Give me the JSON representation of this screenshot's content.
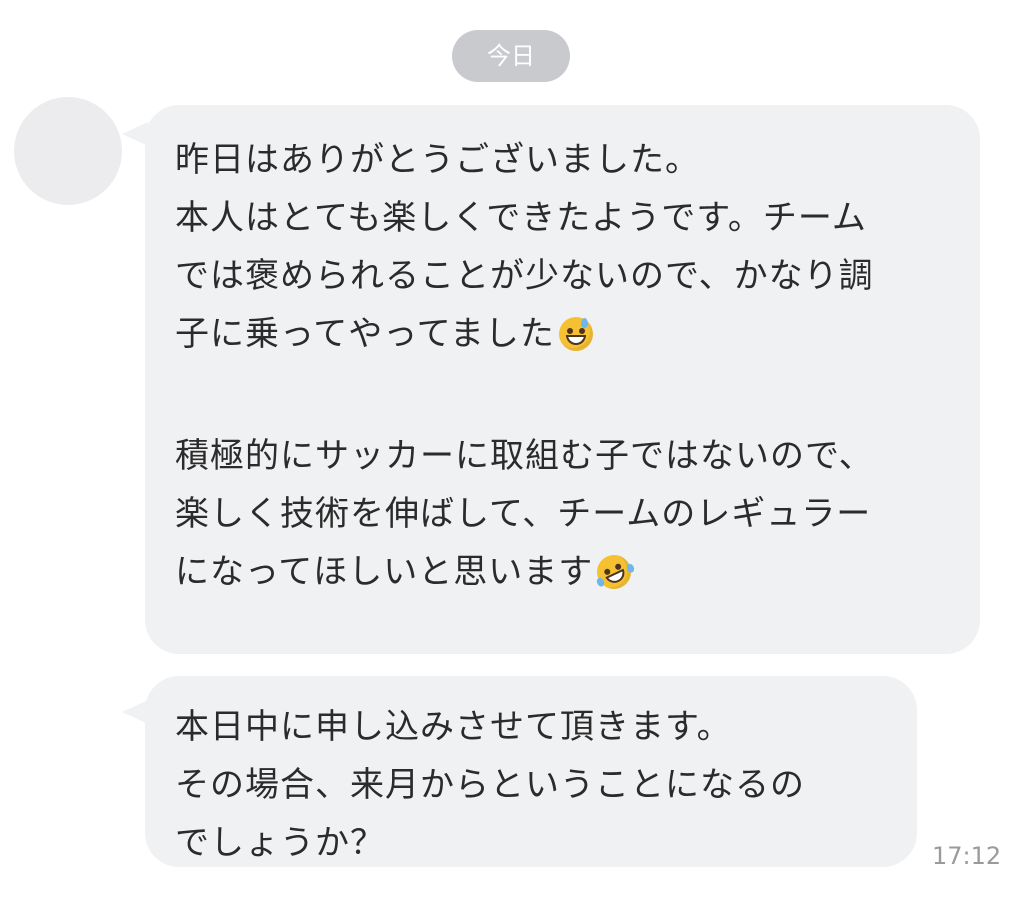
{
  "date_divider": "今日",
  "messages": [
    {
      "lines": [
        "昨日はありがとうございました。",
        "本人はとても楽しくできたようです。チーム",
        "では褒められることが少ないので、かなり調",
        "子に乗ってやってました",
        "",
        "積極的にサッカーに取組む子ではないので、",
        "楽しく技術を伸ばして、チームのレギュラー",
        "になってほしいと思います"
      ],
      "emojis": [
        "grinning-face-with-sweat-icon",
        "rolling-on-the-floor-laughing-icon"
      ]
    },
    {
      "lines": [
        "本日中に申し込みさせて頂きます。",
        "その場合、来月からということになるの",
        "でしょうか？"
      ],
      "time": "17:12"
    }
  ],
  "colors": {
    "bubble": "#f0f1f3",
    "date_pill": "#c9cacd",
    "avatar": "#ececee",
    "text": "#2b2b2b",
    "time": "#9a9a9d"
  }
}
